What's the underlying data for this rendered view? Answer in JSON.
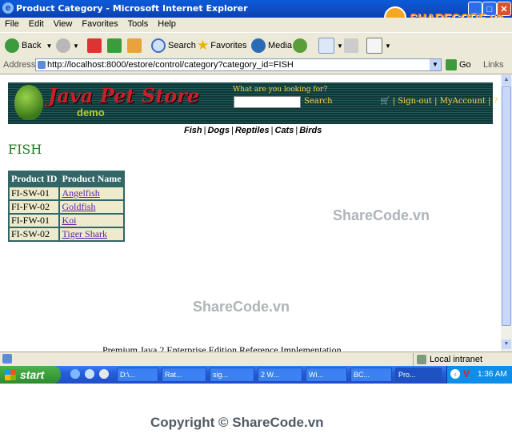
{
  "window": {
    "title": "Product Category - Microsoft Internet Explorer"
  },
  "menu": [
    "File",
    "Edit",
    "View",
    "Favorites",
    "Tools",
    "Help"
  ],
  "toolbar": {
    "back": "Back",
    "search": "Search",
    "favorites": "Favorites",
    "media": "Media"
  },
  "address": {
    "label": "Address",
    "url": "http://localhost:8000/estore/control/category?category_id=FISH",
    "go": "Go",
    "links": "Links"
  },
  "banner": {
    "logo": "Java Pet Store",
    "demo": "demo",
    "search_prompt": "What are you looking for?",
    "search_button": "Search",
    "sign_out": "Sign-out",
    "my_account": "MyAccount",
    "help": "?"
  },
  "categories": [
    "Fish",
    "Dogs",
    "Reptiles",
    "Cats",
    "Birds"
  ],
  "category_title": "FISH",
  "table": {
    "headers": [
      "Product ID",
      "Product Name"
    ],
    "rows": [
      {
        "id": "FI-SW-01",
        "name": "Angelfish"
      },
      {
        "id": "FI-FW-02",
        "name": "Goldfish"
      },
      {
        "id": "FI-FW-01",
        "name": "Koi"
      },
      {
        "id": "FI-SW-02",
        "name": "Tiger Shark"
      }
    ]
  },
  "footer": "Premium Java 2 Enterprise Edition Reference Implementation",
  "status": {
    "zone": "Local intranet"
  },
  "taskbar": {
    "start": "start",
    "tasks": [
      "D:\\...",
      "Rat...",
      "sig...",
      "2 W...",
      "Wi...",
      "BC...",
      "Pro..."
    ],
    "clock": "1:36 AM"
  },
  "watermarks": {
    "top_right": "SHARECODE.vn",
    "mid": "ShareCode.vn",
    "copyright": "Copyright © ShareCode.vn"
  }
}
